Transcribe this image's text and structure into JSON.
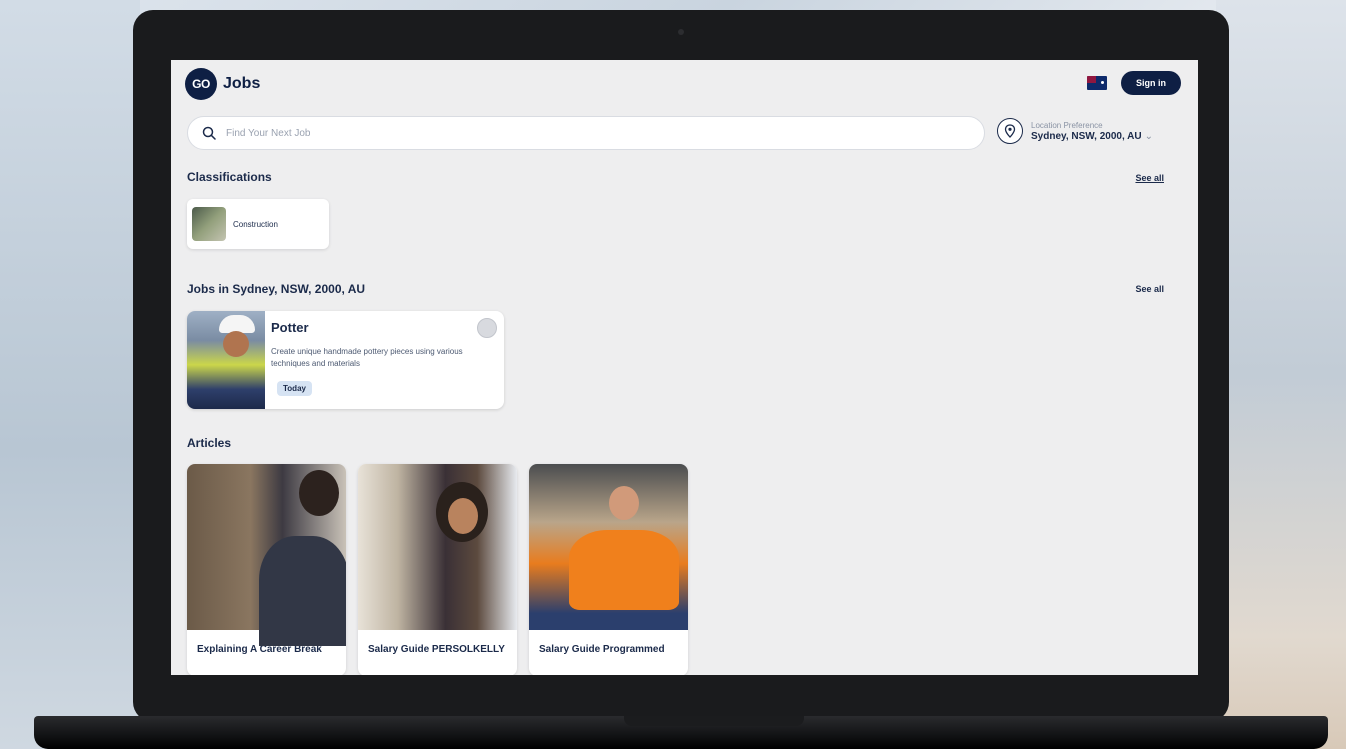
{
  "app": {
    "logo_mark": "GO",
    "title": "Jobs",
    "signin_label": "Sign in"
  },
  "search": {
    "placeholder": "Find Your Next Job"
  },
  "location": {
    "label": "Location Preference",
    "value": "Sydney, NSW, 2000, AU"
  },
  "classifications": {
    "title": "Classifications",
    "see_all": "See all",
    "items": [
      {
        "label": "Construction"
      }
    ]
  },
  "jobs": {
    "title": "Jobs in Sydney, NSW, 2000, AU",
    "see_all": "See all",
    "items": [
      {
        "title": "Potter",
        "description": "Create unique handmade pottery pieces using various techniques and materials",
        "badge": "Today"
      }
    ]
  },
  "articles": {
    "title": "Articles",
    "items": [
      {
        "title": "Explaining A Career Break"
      },
      {
        "title": "Salary Guide PERSOLKELLY"
      },
      {
        "title": "Salary Guide Programmed"
      }
    ]
  },
  "colors": {
    "brand_navy": "#0e1f44",
    "badge_bg": "#d6e3f3",
    "screen_bg": "#eeeeef"
  },
  "icons": [
    "search-icon",
    "location-pin-icon",
    "chevron-down-icon",
    "australia-flag-icon",
    "bookmark-icon"
  ]
}
